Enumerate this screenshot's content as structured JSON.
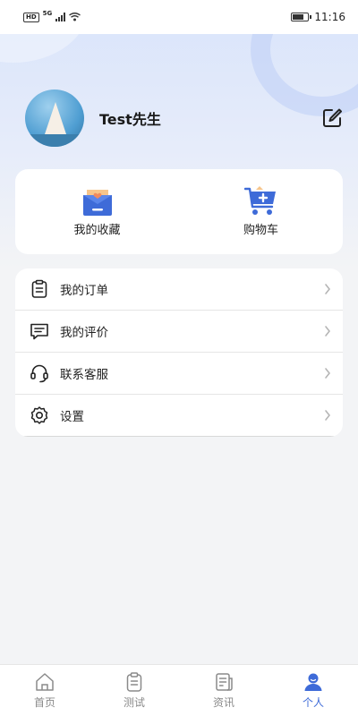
{
  "status_bar": {
    "left_badge": "HD",
    "network": "5G",
    "time": "11:16"
  },
  "profile": {
    "username": "Test先生"
  },
  "quick_actions": [
    {
      "label": "我的收藏",
      "icon": "favorites-icon"
    },
    {
      "label": "购物车",
      "icon": "cart-icon"
    }
  ],
  "menu": [
    {
      "label": "我的订单",
      "icon": "order-icon"
    },
    {
      "label": "我的评价",
      "icon": "review-icon"
    },
    {
      "label": "联系客服",
      "icon": "headset-icon"
    },
    {
      "label": "设置",
      "icon": "gear-icon"
    }
  ],
  "bottom_nav": [
    {
      "label": "首页",
      "icon": "home-icon"
    },
    {
      "label": "测试",
      "icon": "clipboard-icon"
    },
    {
      "label": "资讯",
      "icon": "news-icon"
    },
    {
      "label": "个人",
      "icon": "user-icon",
      "active": true
    }
  ],
  "colors": {
    "accent": "#3e6bd8",
    "inactive": "#8a8a8a",
    "background": "#f3f4f6"
  }
}
